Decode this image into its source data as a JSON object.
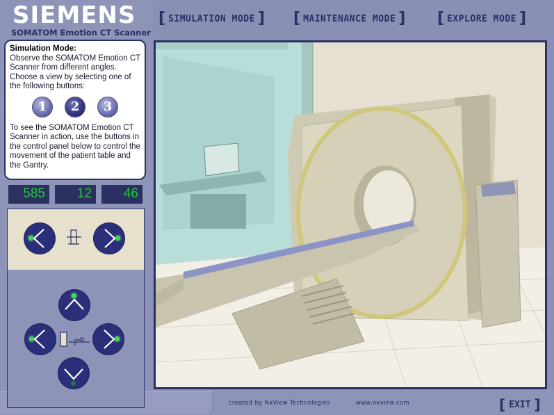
{
  "brand": {
    "logo": "SIEMENS",
    "product": "SOMATOM Emotion CT Scanner"
  },
  "nav": {
    "open_bracket": "[",
    "close_bracket": "]",
    "items": [
      "SIMULATION MODE",
      "MAINTENANCE MODE",
      "EXPLORE MODE"
    ]
  },
  "info": {
    "heading": "Simulation Mode:",
    "intro": "Observe the SOMATOM Emotion CT Scanner from different angles. Choose a view by selecting one of the following buttons:",
    "view_buttons": [
      "1",
      "2",
      "3"
    ],
    "active_view": "2",
    "outro": "To see the SOMATOM Emotion CT Scanner in action, use the buttons in the control panel below to control the movement of the patient table and the Gantry."
  },
  "counters": [
    "585",
    "12",
    "46"
  ],
  "control_panel": {
    "gantry_icon": "gantry-tilt-icon",
    "table_icon": "patient-table-icon",
    "arrow_icons": [
      "chevron-left-icon",
      "chevron-right-icon",
      "chevron-up-icon",
      "chevron-down-icon"
    ],
    "indicator_color": "#39e03f"
  },
  "colors": {
    "accent": "#2b2f66",
    "button": "#2b2f7a",
    "panel": "#8e93b8",
    "counter_bg": "#2a3160",
    "counter_text": "#22c83a"
  },
  "footer": {
    "credit": "created by NxView Technologies",
    "url": "www.nxview.com"
  },
  "exit": {
    "open_bracket": "[",
    "label": "EXIT",
    "close_bracket": "]"
  }
}
